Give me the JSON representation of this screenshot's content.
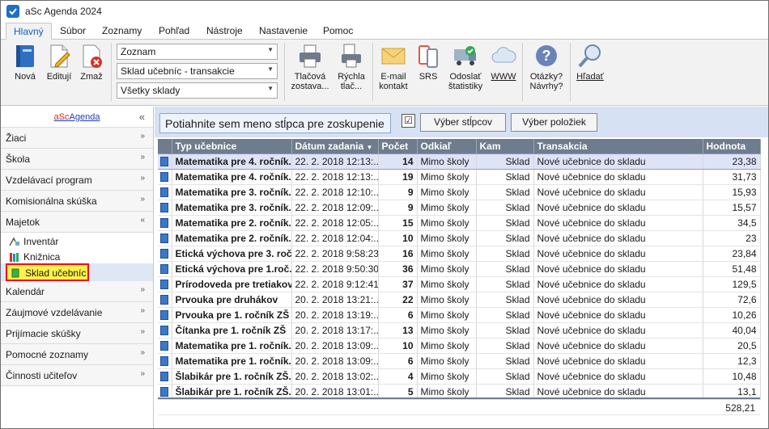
{
  "window": {
    "title": "aSc Agenda 2024"
  },
  "menu": {
    "tabs": [
      "Hlavný",
      "Súbor",
      "Zoznamy",
      "Pohľad",
      "Nástroje",
      "Nastavenie",
      "Pomoc"
    ],
    "active": "Hlavný"
  },
  "ribbon": {
    "new": "Nová",
    "edit": "Editují",
    "delete": "Zmaž",
    "combo1": "Zoznam",
    "combo2": "Sklad učebníc - transakcie",
    "combo3": "Všetky sklady",
    "print_1": "Tlačová",
    "print_2": "zostava...",
    "quick_1": "Rýchla",
    "quick_2": "tlač...",
    "email_1": "E-mail",
    "email_2": "kontakt",
    "srs": "SRS",
    "send_1": "Odoslať",
    "send_2": "štatistiky",
    "www": "WWW",
    "questions_1": "Otázky?",
    "questions_2": "Návrhy?",
    "search": "Hľadať"
  },
  "sidebar": {
    "logo_a": "aSc",
    "logo_b": "Agenda",
    "sections_top": [
      "Žiaci",
      "Škola",
      "Vzdelávací program",
      "Komisionálna skúška",
      "Majetok"
    ],
    "items": [
      "Inventár",
      "Knižnica",
      "Sklad učebníc"
    ],
    "selected": "Sklad učebníc",
    "sections_bottom": [
      "Kalendár",
      "Záujmové vzdelávanie",
      "Prijímacie skúšky",
      "Pomocné zoznamy",
      "Činnosti učiteľov"
    ]
  },
  "toolbar": {
    "group_hint": "Potiahnite sem meno stĺpca pre zoskupenie",
    "checkbox_mark": "☑",
    "select_columns": "Výber stĺpcov",
    "select_items": "Výber položiek"
  },
  "grid": {
    "columns": [
      "Typ učebnice",
      "Dátum zadania",
      "Počet",
      "Odkiaľ",
      "Kam",
      "Transakcia",
      "Hodnota"
    ],
    "rows": [
      [
        "Matematika pre 4. ročník...",
        "22. 2. 2018 12:13:...",
        "14",
        "Mimo školy",
        "Sklad",
        "Nové učebnice do skladu",
        "23,38"
      ],
      [
        "Matematika pre 4. ročník...",
        "22. 2. 2018 12:13:...",
        "19",
        "Mimo školy",
        "Sklad",
        "Nové učebnice do skladu",
        "31,73"
      ],
      [
        "Matematika pre 3. ročník...",
        "22. 2. 2018 12:10:...",
        "9",
        "Mimo školy",
        "Sklad",
        "Nové učebnice do skladu",
        "15,93"
      ],
      [
        "Matematika pre 3. ročník...",
        "22. 2. 2018 12:09:...",
        "9",
        "Mimo školy",
        "Sklad",
        "Nové učebnice do skladu",
        "15,57"
      ],
      [
        "Matematika pre 2. ročník...",
        "22. 2. 2018 12:05:...",
        "15",
        "Mimo školy",
        "Sklad",
        "Nové učebnice do skladu",
        "34,5"
      ],
      [
        "Matematika pre 2. ročník...",
        "22. 2. 2018 12:04:...",
        "10",
        "Mimo školy",
        "Sklad",
        "Nové učebnice do skladu",
        "23"
      ],
      [
        "Etická výchova pre 3. roč...",
        "22. 2. 2018 9:58:23",
        "16",
        "Mimo školy",
        "Sklad",
        "Nové učebnice do skladu",
        "23,84"
      ],
      [
        "Etická výchova pre 1.roč...",
        "22. 2. 2018 9:50:30",
        "36",
        "Mimo školy",
        "Sklad",
        "Nové učebnice do skladu",
        "51,48"
      ],
      [
        "Prírodoveda pre tretiakov",
        "22. 2. 2018 9:12:41",
        "37",
        "Mimo školy",
        "Sklad",
        "Nové učebnice do skladu",
        "129,5"
      ],
      [
        "Prvouka pre druhákov",
        "20. 2. 2018 13:21:...",
        "22",
        "Mimo školy",
        "Sklad",
        "Nové učebnice do skladu",
        "72,6"
      ],
      [
        "Prvouka pre 1. ročník ZŠ",
        "20. 2. 2018 13:19:...",
        "6",
        "Mimo školy",
        "Sklad",
        "Nové učebnice do skladu",
        "10,26"
      ],
      [
        "Čítanka pre 1. ročník ZŠ",
        "20. 2. 2018 13:17:...",
        "13",
        "Mimo školy",
        "Sklad",
        "Nové učebnice do skladu",
        "40,04"
      ],
      [
        "Matematika pre 1. ročník...",
        "20. 2. 2018 13:09:...",
        "10",
        "Mimo školy",
        "Sklad",
        "Nové učebnice do skladu",
        "20,5"
      ],
      [
        "Matematika pre 1. ročník...",
        "20. 2. 2018 13:09:...",
        "6",
        "Mimo školy",
        "Sklad",
        "Nové učebnice do skladu",
        "12,3"
      ],
      [
        "Šlabikár pre 1. ročník ZŠ...",
        "20. 2. 2018 13:02:...",
        "4",
        "Mimo školy",
        "Sklad",
        "Nové učebnice do skladu",
        "10,48"
      ],
      [
        "Šlabikár pre 1. ročník ZŠ...",
        "20. 2. 2018 13:01:...",
        "5",
        "Mimo školy",
        "Sklad",
        "Nové učebnice do skladu",
        "13,1"
      ]
    ],
    "total": "528,21"
  },
  "colors": {
    "accent": "#1060c0",
    "header": "#6f7c8e",
    "highlight": "#fdf14a",
    "highlight_border": "#e8101a"
  }
}
